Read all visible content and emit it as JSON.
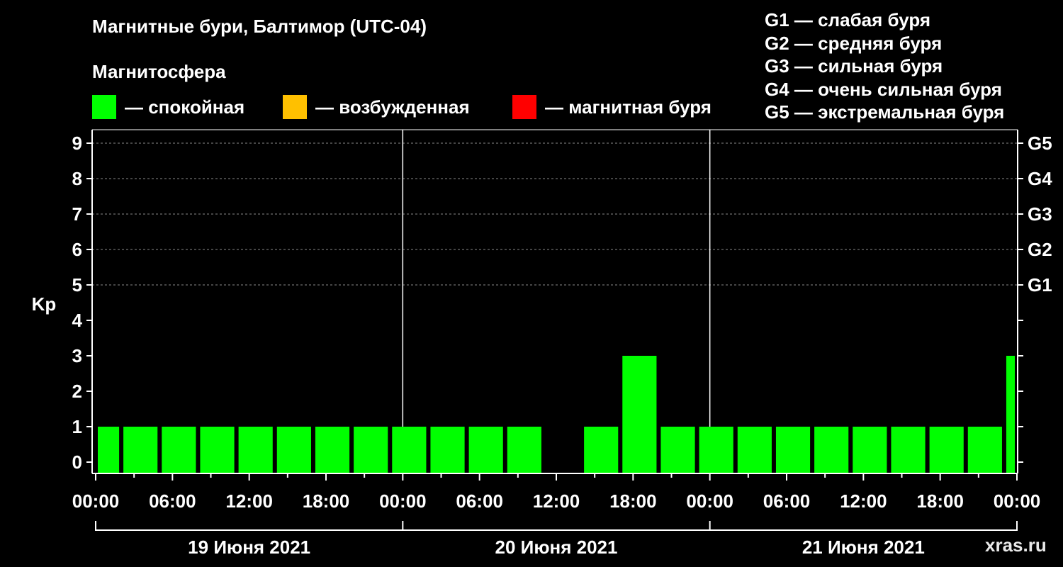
{
  "chart_data": {
    "type": "bar",
    "title": "Магнитные бури, Балтимор (UTC-04)",
    "subtitle": "Магнитосфера",
    "ylabel": "Kp",
    "ylim": [
      0,
      9
    ],
    "y_ticks": [
      "0",
      "1",
      "2",
      "3",
      "4",
      "5",
      "6",
      "7",
      "8",
      "9"
    ],
    "y_right_ticks": [
      {
        "value": 5,
        "label": "G1"
      },
      {
        "value": 6,
        "label": "G2"
      },
      {
        "value": 7,
        "label": "G3"
      },
      {
        "value": 8,
        "label": "G4"
      },
      {
        "value": 9,
        "label": "G5"
      }
    ],
    "grid": "dashed horizontal at 5–9",
    "x_unit": "hours from 19 June 2021 00:00 (UTC-04)",
    "x_range": [
      0,
      72
    ],
    "x_tick_labels": [
      "00:00",
      "06:00",
      "12:00",
      "18:00",
      "00:00",
      "06:00",
      "12:00",
      "18:00",
      "00:00",
      "06:00",
      "12:00",
      "18:00",
      "00:00"
    ],
    "day_labels": [
      "19 Июня 2021",
      "20 Июня 2021",
      "21 Июня 2021"
    ],
    "bars": [
      {
        "start": 0,
        "end": 2,
        "kp": 1
      },
      {
        "start": 2,
        "end": 5,
        "kp": 1
      },
      {
        "start": 5,
        "end": 8,
        "kp": 1
      },
      {
        "start": 8,
        "end": 11,
        "kp": 1
      },
      {
        "start": 11,
        "end": 14,
        "kp": 1
      },
      {
        "start": 14,
        "end": 17,
        "kp": 1
      },
      {
        "start": 17,
        "end": 20,
        "kp": 1
      },
      {
        "start": 20,
        "end": 23,
        "kp": 1
      },
      {
        "start": 23,
        "end": 26,
        "kp": 1
      },
      {
        "start": 26,
        "end": 29,
        "kp": 1
      },
      {
        "start": 29,
        "end": 32,
        "kp": 1
      },
      {
        "start": 32,
        "end": 35,
        "kp": 1
      },
      {
        "start": 35,
        "end": 38,
        "kp": 0
      },
      {
        "start": 38,
        "end": 41,
        "kp": 1
      },
      {
        "start": 41,
        "end": 44,
        "kp": 3
      },
      {
        "start": 44,
        "end": 47,
        "kp": 1
      },
      {
        "start": 47,
        "end": 50,
        "kp": 1
      },
      {
        "start": 50,
        "end": 53,
        "kp": 1
      },
      {
        "start": 53,
        "end": 56,
        "kp": 1
      },
      {
        "start": 56,
        "end": 59,
        "kp": 1
      },
      {
        "start": 59,
        "end": 62,
        "kp": 1
      },
      {
        "start": 62,
        "end": 65,
        "kp": 1
      },
      {
        "start": 65,
        "end": 68,
        "kp": 1
      },
      {
        "start": 68,
        "end": 71,
        "kp": 1
      },
      {
        "start": 71,
        "end": 72,
        "kp": 3
      }
    ],
    "colors": {
      "quiet": "#00ff00",
      "excited": "#ffc000",
      "storm": "#ff0000"
    }
  },
  "legend": [
    {
      "label": "— спокойная",
      "color": "#00ff00"
    },
    {
      "label": "— возбужденная",
      "color": "#ffc000"
    },
    {
      "label": "— магнитная буря",
      "color": "#ff0000"
    }
  ],
  "storm_scale": [
    "G1 — слабая буря",
    "G2 — средняя буря",
    "G3 — сильная буря",
    "G4 — очень сильная буря",
    "G5 — экстремальная буря"
  ],
  "watermark": "xras.ru"
}
